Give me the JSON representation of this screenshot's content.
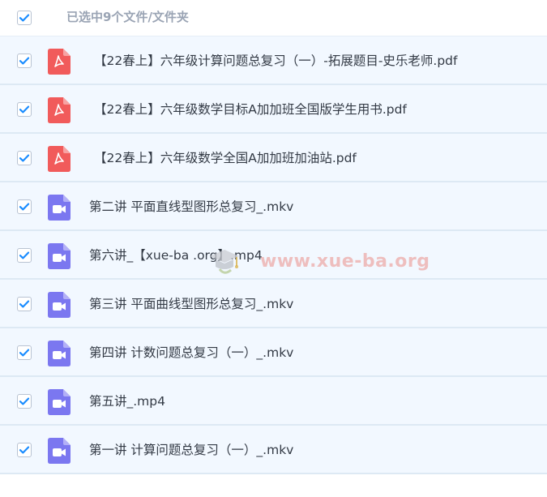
{
  "header": {
    "select_all_checked": true,
    "text": "已选中9个文件/文件夹"
  },
  "files": [
    {
      "name": "【22春上】六年级计算问题总复习（一）-拓展题目-史乐老师.pdf",
      "type": "pdf",
      "checked": true
    },
    {
      "name": "【22春上】六年级数学目标A加加班全国版学生用书.pdf",
      "type": "pdf",
      "checked": true
    },
    {
      "name": "【22春上】六年级数学全国A加加班加油站.pdf",
      "type": "pdf",
      "checked": true
    },
    {
      "name": "第二讲 平面直线型图形总复习_.mkv",
      "type": "video",
      "checked": true
    },
    {
      "name": "第六讲_【xue-ba .org】.mp4",
      "type": "video",
      "checked": true
    },
    {
      "name": "第三讲 平面曲线型图形总复习_.mkv",
      "type": "video",
      "checked": true
    },
    {
      "name": "第四讲 计数问题总复习（一）_.mkv",
      "type": "video",
      "checked": true
    },
    {
      "name": "第五讲_.mp4",
      "type": "video",
      "checked": true
    },
    {
      "name": "第一讲 计算问题总复习（一）_.mkv",
      "type": "video",
      "checked": true
    }
  ],
  "watermark": {
    "text": "www.xue-ba.org",
    "icon": "graduation-cap-icon"
  },
  "colors": {
    "check_blue": "#1a8cff",
    "pdf_red": "#f15b5b",
    "video_purple": "#7b77f0",
    "row_bg": "#f2f8ff",
    "divider": "#dde9f4",
    "header_text": "#9aa4b4"
  }
}
